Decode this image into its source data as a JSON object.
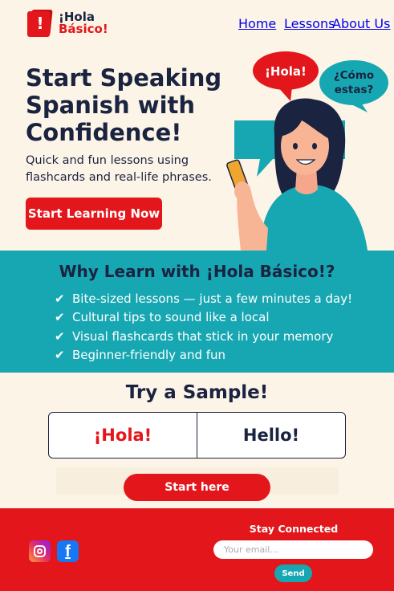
{
  "brand": {
    "line1": "¡Hola",
    "line2": "Básico!",
    "logo_icon": "book-exclamation-icon",
    "colors": {
      "red": "#e3161b",
      "navy": "#1a2340",
      "teal": "#17a7b2",
      "cream": "#fdf4e8"
    }
  },
  "nav": {
    "home": "Home",
    "lessons": "Lessons",
    "about": "About Us"
  },
  "hero": {
    "title": "Start Speaking Spanish with Confidence!",
    "subtitle": "Quick and fun lessons using flashcards and real-life phrases.",
    "cta": "Start Learning Now",
    "bubble_red": "¡Hola!",
    "bubble_teal": "¿Cómo estas?"
  },
  "why": {
    "title": "Why Learn with ¡Hola Básico!?",
    "items": [
      "Bite-sized lessons — just a few minutes a day!",
      "Cultural tips to sound like a local",
      "Visual flashcards that stick in your memory",
      "Beginner-friendly and fun"
    ],
    "check_icon": "✔"
  },
  "sample": {
    "title": "Try a Sample!",
    "spanish": "¡Hola!",
    "english": "Hello!",
    "button": "Start here"
  },
  "footer": {
    "stay_connected": "Stay Connected",
    "email_placeholder": "Your email...",
    "send": "Send",
    "social": [
      "instagram-icon",
      "facebook-icon"
    ]
  }
}
